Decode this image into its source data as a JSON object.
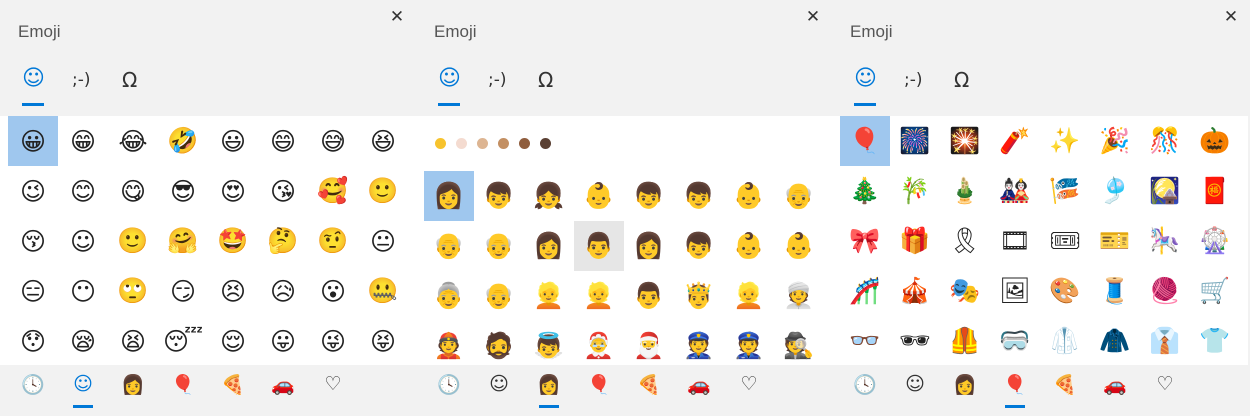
{
  "panels": [
    {
      "title": "Emoji",
      "tabs": [
        "☺",
        ";-)",
        "Ω"
      ],
      "close": "✕",
      "grid": [
        "😀",
        "😁",
        "😂",
        "🤣",
        "😃",
        "😄",
        "😅",
        "😆",
        "😉",
        "😊",
        "😋",
        "😎",
        "😍",
        "😘",
        "🥰",
        "🙂",
        "😚",
        "☺",
        "🙂",
        "🤗",
        "🤩",
        "🤔",
        "🤨",
        "😐",
        "😑",
        "😶",
        "🙄",
        "😏",
        "😣",
        "😥",
        "😮",
        "🤐",
        "😯",
        "😪",
        "😫",
        "😴",
        "😌",
        "😛",
        "😜",
        "😝"
      ],
      "selected_index": 0,
      "hover_index": -1,
      "active_category": 1
    },
    {
      "title": "Emoji",
      "tabs": [
        "☺",
        ";-)",
        "Ω"
      ],
      "close": "✕",
      "skin_tones": [
        "#f7c32d",
        "#f4dbd0",
        "#ddb592",
        "#c38f62",
        "#8f5d3d",
        "#5a4033"
      ],
      "grid": [
        "👩",
        "👦",
        "👧",
        "👶",
        "👦",
        "👦",
        "👶",
        "👴",
        "👴",
        "👴",
        "👩",
        "👨",
        "👩",
        "👦",
        "👶",
        "👶",
        "👵",
        "👴",
        "👱",
        "👱",
        "👨",
        "🤴",
        "👱",
        "👳",
        "👲",
        "🧔",
        "👼",
        "🤶",
        "🎅",
        "👮",
        "👮",
        "🕵"
      ],
      "selected_index": 0,
      "hover_index": 11,
      "active_category": 2
    },
    {
      "title": "Emoji",
      "tabs": [
        "☺",
        ";-)",
        "Ω"
      ],
      "close": "✕",
      "grid": [
        "🎈",
        "🎆",
        "🎇",
        "🧨",
        "✨",
        "🎉",
        "🎊",
        "🎃",
        "🎄",
        "🎋",
        "🎍",
        "🎎",
        "🎏",
        "🎐",
        "🎑",
        "🧧",
        "🎀",
        "🎁",
        "🎗",
        "🎞",
        "🎟",
        "🎫",
        "🎠",
        "🎡",
        "🎢",
        "🎪",
        "🎭",
        "🖼",
        "🎨",
        "🧵",
        "🧶",
        "🛒",
        "👓",
        "🕶",
        "🦺",
        "🥽",
        "🥼",
        "🧥",
        "👔",
        "👕"
      ],
      "selected_index": 0,
      "hover_index": -1,
      "active_category": 3
    }
  ],
  "categories": [
    "🕓",
    "☺",
    "👩",
    "🎈",
    "🍕",
    "🚗",
    "♡"
  ]
}
